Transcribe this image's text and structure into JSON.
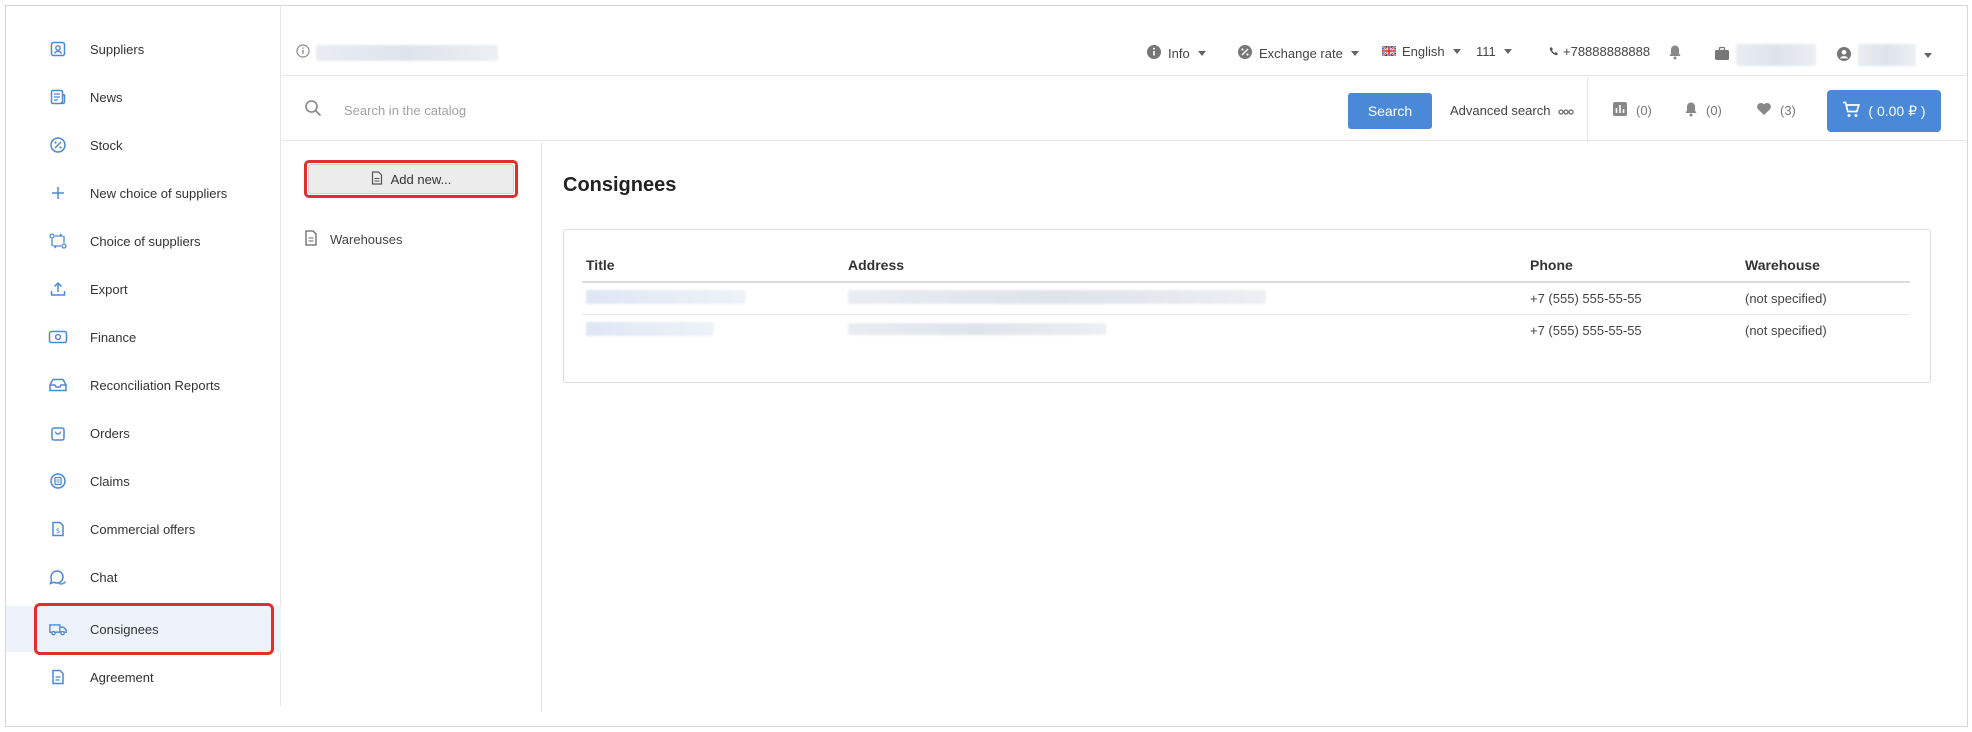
{
  "sidebar": {
    "items": [
      {
        "label": "Suppliers",
        "icon": "supplier-icon"
      },
      {
        "label": "News",
        "icon": "news-icon"
      },
      {
        "label": "Stock",
        "icon": "percent-icon"
      },
      {
        "label": "New choice of suppliers",
        "icon": "plus-icon"
      },
      {
        "label": "Choice of suppliers",
        "icon": "swap-icon"
      },
      {
        "label": "Export",
        "icon": "upload-icon"
      },
      {
        "label": "Finance",
        "icon": "money-icon"
      },
      {
        "label": "Reconciliation Reports",
        "icon": "inbox-icon"
      },
      {
        "label": "Orders",
        "icon": "bag-icon"
      },
      {
        "label": "Claims",
        "icon": "claims-icon"
      },
      {
        "label": "Commercial offers",
        "icon": "dollar-doc-icon"
      },
      {
        "label": "Chat",
        "icon": "chat-icon"
      },
      {
        "label": "Consignees",
        "icon": "truck-icon"
      },
      {
        "label": "Agreement",
        "icon": "document-icon"
      }
    ],
    "active": "Consignees"
  },
  "topbar": {
    "info_label": "Info",
    "exchange_label": "Exchange rate",
    "language_label": "English",
    "number_label": "111",
    "phone": "+78888888888"
  },
  "search": {
    "placeholder": "Search in the catalog",
    "button_label": "Search",
    "advanced_label": "Advanced search"
  },
  "counters": {
    "compare": "(0)",
    "notifications": "(0)",
    "favorites": "(3)",
    "cart": "( 0.00 ₽ )"
  },
  "subpanel": {
    "add_label": "Add new...",
    "warehouses_label": "Warehouses"
  },
  "main": {
    "title": "Consignees",
    "columns": [
      "Title",
      "Address",
      "Phone",
      "Warehouse"
    ],
    "rows": [
      {
        "phone": "+7 (555) 555-55-55",
        "warehouse": "(not specified)"
      },
      {
        "phone": "+7 (555) 555-55-55",
        "warehouse": "(not specified)"
      }
    ]
  },
  "colors": {
    "accent": "#4a88d8",
    "highlight": "#e0302b",
    "active_bg": "#eef3fb"
  }
}
